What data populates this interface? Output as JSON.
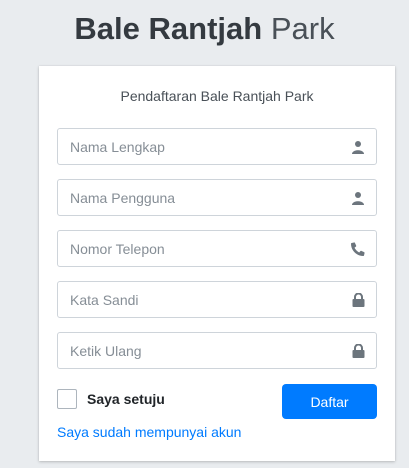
{
  "brand": {
    "strong": "Bale Rantjah",
    "light": "Park"
  },
  "form": {
    "title": "Pendaftaran Bale Rantjah Park",
    "fields": [
      {
        "placeholder": "Nama Lengkap",
        "icon": "user-icon"
      },
      {
        "placeholder": "Nama Pengguna",
        "icon": "user-icon"
      },
      {
        "placeholder": "Nomor Telepon",
        "icon": "phone-icon"
      },
      {
        "placeholder": "Kata Sandi",
        "icon": "lock-icon"
      },
      {
        "placeholder": "Ketik Ulang",
        "icon": "lock-icon"
      }
    ],
    "agree_label": "Saya setuju",
    "submit_label": "Daftar",
    "login_link": "Saya sudah mempunyai akun"
  },
  "colors": {
    "primary": "#007bff",
    "background": "#e9ecef",
    "icon": "#6c757d"
  }
}
